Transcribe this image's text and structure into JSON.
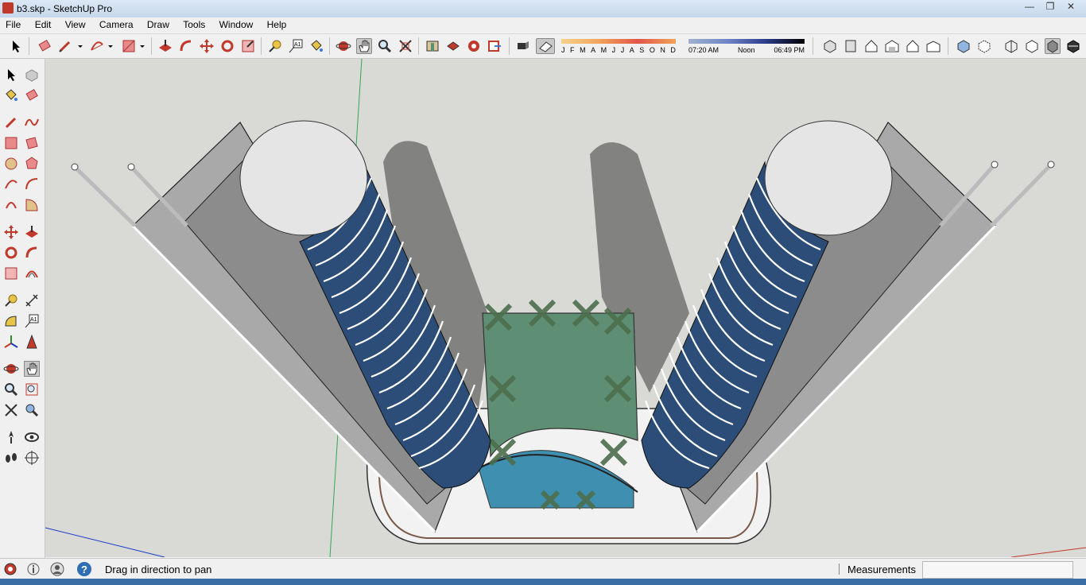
{
  "window": {
    "title": "b3.skp - SketchUp Pro",
    "minimize_icon": "minimize-icon",
    "maximize_icon": "maximize-icon",
    "close_icon": "close-icon"
  },
  "menu": [
    "File",
    "Edit",
    "View",
    "Camera",
    "Draw",
    "Tools",
    "Window",
    "Help"
  ],
  "toolbar": {
    "months": [
      "J",
      "F",
      "M",
      "A",
      "M",
      "J",
      "J",
      "A",
      "S",
      "O",
      "N",
      "D"
    ],
    "time_start": "07:20 AM",
    "time_mid": "Noon",
    "time_end": "06:49 PM"
  },
  "statusbar": {
    "hint": "Drag in direction to pan",
    "measurements_label": "Measurements",
    "measurements_value": ""
  },
  "tools": {
    "active": "pan"
  },
  "colors": {
    "glass": "#2b4d78",
    "roof": "#5e8f74",
    "sky_axis_green": "#34a853",
    "axis_blue": "#1a3cc4",
    "axis_red": "#c0392b"
  }
}
